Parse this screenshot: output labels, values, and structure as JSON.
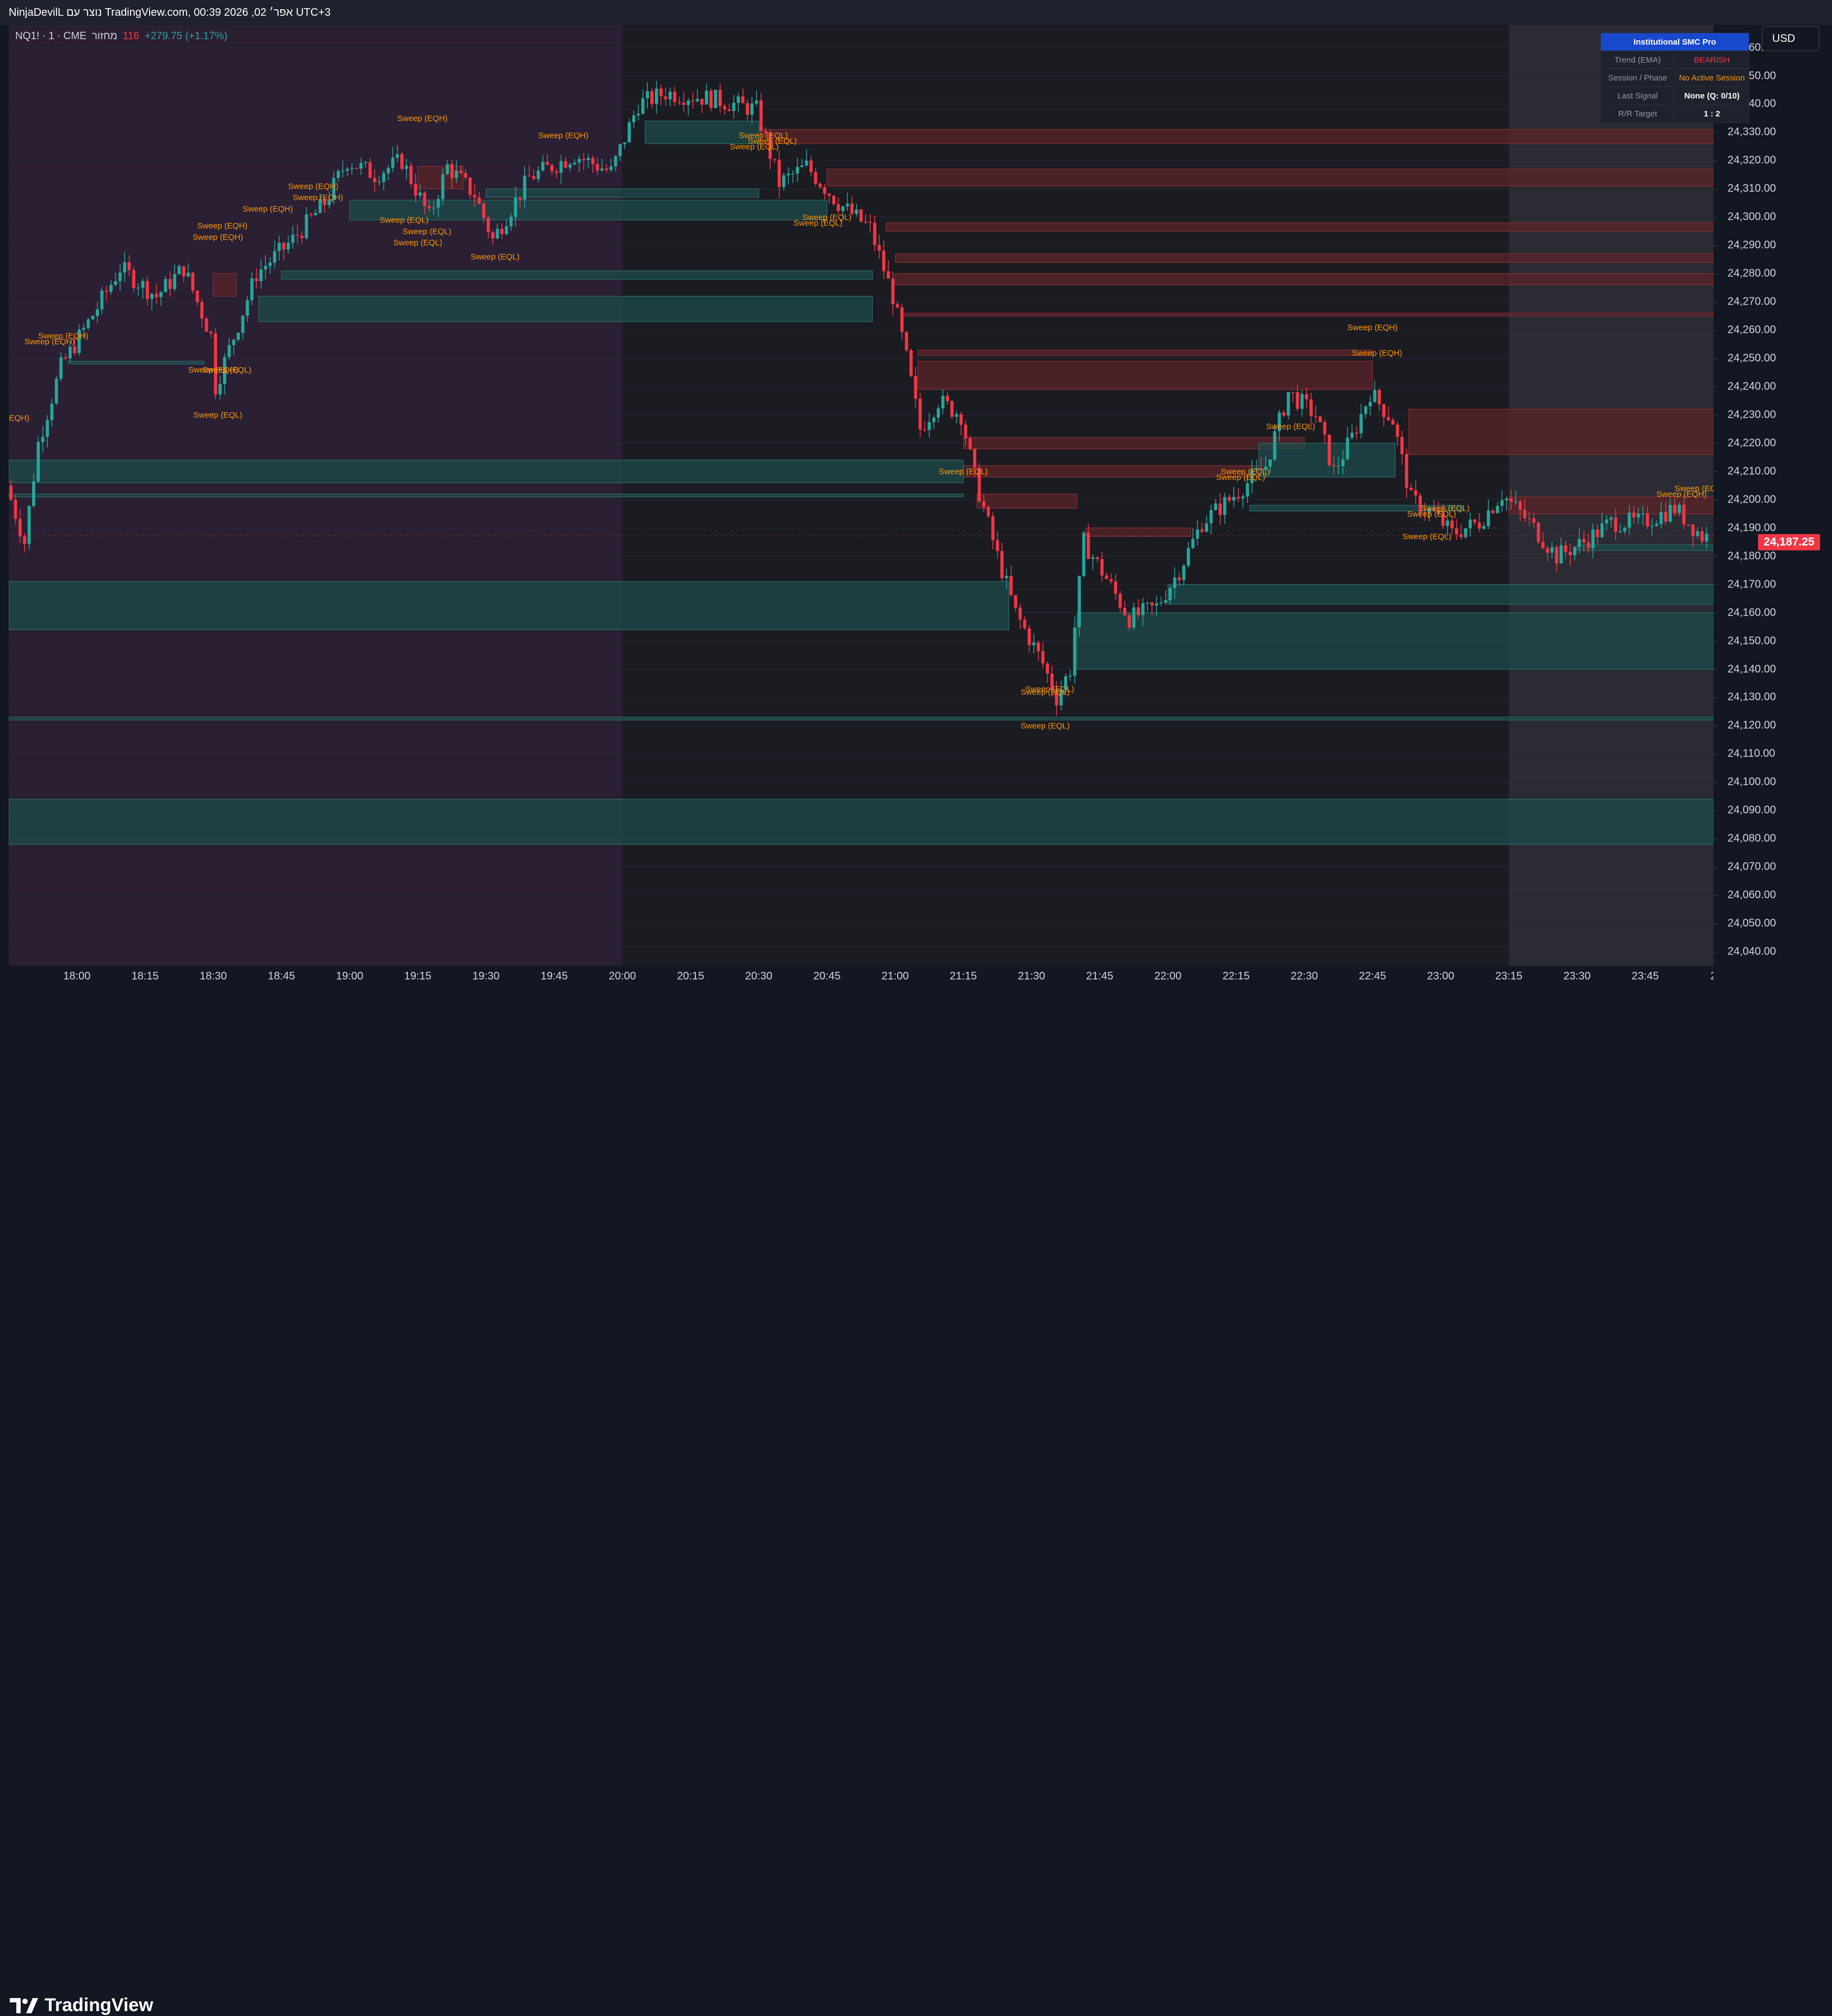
{
  "topbar": {
    "credit_text": "NinjaDevilL נוצר עם TradingView.com, 00:39 2026 ,02 אפר׳ UTC+3"
  },
  "legend": {
    "symbol_text": "NQ1! · 1 · CME",
    "volume_label": "מחזור",
    "volume_value": "116",
    "change_text": "+279.75 (+1.17%)"
  },
  "currency_button": "USD",
  "last_price_label": "24,187.25",
  "smc_table": {
    "title": "Institutional SMC Pro",
    "rows": [
      {
        "key": "Trend (EMA)",
        "value": "BEARISH"
      },
      {
        "key": "Session / Phase",
        "value": "No Active Session"
      },
      {
        "key": "Last Signal",
        "value": "None (Q: 0/10)"
      },
      {
        "key": "R/R Target",
        "value": "1 : 2"
      }
    ]
  },
  "price_axis": {
    "ticks": [
      "24,360.00",
      "24,350.00",
      "24,340.00",
      "24,330.00",
      "24,320.00",
      "24,310.00",
      "24,300.00",
      "24,290.00",
      "24,280.00",
      "24,270.00",
      "24,260.00",
      "24,250.00",
      "24,240.00",
      "24,230.00",
      "24,220.00",
      "24,210.00",
      "24,200.00",
      "24,190.00",
      "24,180.00",
      "24,170.00",
      "24,160.00",
      "24,150.00",
      "24,140.00",
      "24,130.00",
      "24,120.00",
      "24,110.00",
      "24,100.00",
      "24,090.00",
      "24,080.00",
      "24,070.00",
      "24,060.00",
      "24,050.00",
      "24,040.00"
    ]
  },
  "time_axis": {
    "ticks": [
      "7:45",
      "18:00",
      "18:15",
      "18:30",
      "18:45",
      "19:00",
      "19:15",
      "19:30",
      "19:45",
      "20:00",
      "20:15",
      "20:30",
      "20:45",
      "21:00",
      "21:15",
      "21:30",
      "21:45",
      "22:00",
      "22:15",
      "22:30",
      "22:45",
      "23:00",
      "23:15",
      "23:30",
      "23:45",
      "2"
    ]
  },
  "branding": {
    "logo_text": "TradingView",
    "logo_icon": "tradingview-logo-icon"
  },
  "colors": {
    "bull": "#26a69a",
    "bear": "#f23645",
    "sweep_label": "#ff9800",
    "demand_zone": "#1e4b4b",
    "supply_zone": "#5a2428",
    "table_header": "#1848cc"
  },
  "chart_data": {
    "type": "candlestick",
    "y_range": [
      24035,
      24368
    ],
    "x_range": [
      "17:45",
      "00:00"
    ],
    "session_shading": [
      {
        "from": "17:45",
        "to": "20:00",
        "color": "#2a1f33"
      },
      {
        "from": "20:00",
        "to": "23:15",
        "color": "#1b1b22"
      },
      {
        "from": "23:15",
        "to": "00:00",
        "color": "#2a2b33"
      }
    ],
    "price_path": [
      {
        "t": "17:45",
        "p": 24205
      },
      {
        "t": "17:49",
        "p": 24185
      },
      {
        "t": "17:52",
        "p": 24220
      },
      {
        "t": "17:57",
        "p": 24247
      },
      {
        "t": "18:05",
        "p": 24268
      },
      {
        "t": "18:10",
        "p": 24282
      },
      {
        "t": "18:18",
        "p": 24272
      },
      {
        "t": "18:24",
        "p": 24282
      },
      {
        "t": "18:30",
        "p": 24258
      },
      {
        "t": "18:31",
        "p": 24240
      },
      {
        "t": "18:36",
        "p": 24262
      },
      {
        "t": "18:40",
        "p": 24280
      },
      {
        "t": "18:48",
        "p": 24292
      },
      {
        "t": "18:55",
        "p": 24305
      },
      {
        "t": "19:00",
        "p": 24320
      },
      {
        "t": "19:06",
        "p": 24315
      },
      {
        "t": "19:12",
        "p": 24320
      },
      {
        "t": "19:18",
        "p": 24300
      },
      {
        "t": "19:22",
        "p": 24318
      },
      {
        "t": "19:28",
        "p": 24308
      },
      {
        "t": "19:32",
        "p": 24292
      },
      {
        "t": "19:40",
        "p": 24314
      },
      {
        "t": "19:50",
        "p": 24322
      },
      {
        "t": "19:58",
        "p": 24316
      },
      {
        "t": "20:04",
        "p": 24340
      },
      {
        "t": "20:10",
        "p": 24344
      },
      {
        "t": "20:20",
        "p": 24342
      },
      {
        "t": "20:30",
        "p": 24338
      },
      {
        "t": "20:35",
        "p": 24312
      },
      {
        "t": "20:41",
        "p": 24318
      },
      {
        "t": "20:48",
        "p": 24305
      },
      {
        "t": "20:55",
        "p": 24296
      },
      {
        "t": "21:00",
        "p": 24272
      },
      {
        "t": "21:03",
        "p": 24250
      },
      {
        "t": "21:06",
        "p": 24225
      },
      {
        "t": "21:10",
        "p": 24235
      },
      {
        "t": "21:15",
        "p": 24230
      },
      {
        "t": "21:18",
        "p": 24208
      },
      {
        "t": "21:23",
        "p": 24180
      },
      {
        "t": "21:27",
        "p": 24160
      },
      {
        "t": "21:33",
        "p": 24142
      },
      {
        "t": "21:36",
        "p": 24130
      },
      {
        "t": "21:39",
        "p": 24140
      },
      {
        "t": "21:42",
        "p": 24185
      },
      {
        "t": "21:47",
        "p": 24172
      },
      {
        "t": "21:52",
        "p": 24158
      },
      {
        "t": "21:58",
        "p": 24162
      },
      {
        "t": "22:03",
        "p": 24175
      },
      {
        "t": "22:08",
        "p": 24192
      },
      {
        "t": "22:14",
        "p": 24200
      },
      {
        "t": "22:22",
        "p": 24212
      },
      {
        "t": "22:27",
        "p": 24238
      },
      {
        "t": "22:33",
        "p": 24230
      },
      {
        "t": "22:37",
        "p": 24210
      },
      {
        "t": "22:41",
        "p": 24222
      },
      {
        "t": "22:45",
        "p": 24238
      },
      {
        "t": "22:50",
        "p": 24228
      },
      {
        "t": "22:54",
        "p": 24200
      },
      {
        "t": "22:59",
        "p": 24195
      },
      {
        "t": "23:03",
        "p": 24188
      },
      {
        "t": "23:09",
        "p": 24192
      },
      {
        "t": "23:14",
        "p": 24202
      },
      {
        "t": "23:20",
        "p": 24192
      },
      {
        "t": "23:26",
        "p": 24180
      },
      {
        "t": "23:32",
        "p": 24185
      },
      {
        "t": "23:38",
        "p": 24192
      },
      {
        "t": "23:45",
        "p": 24192
      },
      {
        "t": "23:52",
        "p": 24197
      },
      {
        "t": "23:58",
        "p": 24187
      }
    ],
    "zones": [
      {
        "kind": "supply",
        "from": "20:30",
        "to": "00:00",
        "top": 24331,
        "bottom": 24326
      },
      {
        "kind": "supply",
        "from": "20:45",
        "to": "00:00",
        "top": 24317,
        "bottom": 24311
      },
      {
        "kind": "supply",
        "from": "20:58",
        "to": "00:00",
        "top": 24298,
        "bottom": 24295
      },
      {
        "kind": "supply",
        "from": "21:00",
        "to": "00:00",
        "top": 24287,
        "bottom": 24284
      },
      {
        "kind": "supply",
        "from": "21:00",
        "to": "00:00",
        "top": 24280,
        "bottom": 24276
      },
      {
        "kind": "supply",
        "from": "21:02",
        "to": "00:00",
        "top": 24266,
        "bottom": 24265
      },
      {
        "kind": "supply",
        "from": "21:05",
        "to": "22:45",
        "top": 24253,
        "bottom": 24251
      },
      {
        "kind": "supply",
        "from": "21:05",
        "to": "22:45",
        "top": 24249,
        "bottom": 24239
      },
      {
        "kind": "supply",
        "from": "22:53",
        "to": "00:00",
        "top": 24232,
        "bottom": 24216
      },
      {
        "kind": "supply",
        "from": "21:15",
        "to": "22:30",
        "top": 24222,
        "bottom": 24218
      },
      {
        "kind": "supply",
        "from": "21:15",
        "to": "22:20",
        "top": 24212,
        "bottom": 24208
      },
      {
        "kind": "supply",
        "from": "21:18",
        "to": "21:40",
        "top": 24202,
        "bottom": 24197
      },
      {
        "kind": "supply",
        "from": "23:15",
        "to": "00:00",
        "top": 24201,
        "bottom": 24195
      },
      {
        "kind": "supply",
        "from": "21:42",
        "to": "22:05",
        "top": 24190,
        "bottom": 24187
      },
      {
        "kind": "supply",
        "from": "18:30",
        "to": "18:35",
        "top": 24280,
        "bottom": 24272
      },
      {
        "kind": "supply",
        "from": "19:15",
        "to": "19:25",
        "top": 24318,
        "bottom": 24310
      },
      {
        "kind": "demand",
        "from": "20:05",
        "to": "20:30",
        "top": 24334,
        "bottom": 24326
      },
      {
        "kind": "demand",
        "from": "19:30",
        "to": "20:30",
        "top": 24310,
        "bottom": 24307
      },
      {
        "kind": "demand",
        "from": "19:00",
        "to": "20:45",
        "top": 24306,
        "bottom": 24299
      },
      {
        "kind": "demand",
        "from": "18:45",
        "to": "20:55",
        "top": 24281,
        "bottom": 24278
      },
      {
        "kind": "demand",
        "from": "18:40",
        "to": "20:55",
        "top": 24272,
        "bottom": 24263
      },
      {
        "kind": "demand",
        "from": "17:58",
        "to": "18:28",
        "top": 24249,
        "bottom": 24248
      },
      {
        "kind": "demand",
        "from": "17:45",
        "to": "21:15",
        "top": 24214,
        "bottom": 24206
      },
      {
        "kind": "demand",
        "from": "17:45",
        "to": "21:15",
        "top": 24202,
        "bottom": 24201
      },
      {
        "kind": "demand",
        "from": "22:20",
        "to": "22:50",
        "top": 24220,
        "bottom": 24208
      },
      {
        "kind": "demand",
        "from": "22:18",
        "to": "23:05",
        "top": 24198,
        "bottom": 24196
      },
      {
        "kind": "demand",
        "from": "17:45",
        "to": "21:25",
        "top": 24171,
        "bottom": 24154
      },
      {
        "kind": "demand",
        "from": "22:00",
        "to": "00:00",
        "top": 24170,
        "bottom": 24163
      },
      {
        "kind": "demand",
        "from": "21:40",
        "to": "00:00",
        "top": 24160,
        "bottom": 24140
      },
      {
        "kind": "demand",
        "from": "23:30",
        "to": "00:00",
        "top": 24184,
        "bottom": 24182
      },
      {
        "kind": "demand",
        "from": "17:45",
        "to": "00:00",
        "top": 24123,
        "bottom": 24122
      },
      {
        "kind": "demand",
        "from": "17:45",
        "to": "00:00",
        "top": 24094,
        "bottom": 24078
      }
    ],
    "labels": [
      {
        "text": "Sweep (EQH)",
        "t": "19:16",
        "p": 24334
      },
      {
        "text": "Sweep (EQH)",
        "t": "19:47",
        "p": 24328
      },
      {
        "text": "Sweep (EQH)",
        "t": "18:42",
        "p": 24302
      },
      {
        "text": "Sweep (EQH)",
        "t": "18:52",
        "p": 24310
      },
      {
        "text": "Sweep (EQH)",
        "t": "18:53",
        "p": 24306
      },
      {
        "text": "Sweep (EQH)",
        "t": "18:32",
        "p": 24296
      },
      {
        "text": "Sweep (EQH)",
        "t": "18:31",
        "p": 24292
      },
      {
        "text": "Sweep (EQL)",
        "t": "19:12",
        "p": 24298
      },
      {
        "text": "Sweep (EQL)",
        "t": "19:17",
        "p": 24294
      },
      {
        "text": "Sweep (EQL)",
        "t": "19:15",
        "p": 24290
      },
      {
        "text": "Sweep (EQL)",
        "t": "19:32",
        "p": 24285
      },
      {
        "text": "Sweep (EQH)",
        "t": "17:57",
        "p": 24257
      },
      {
        "text": "Sweep (EQH)",
        "t": "17:54",
        "p": 24255
      },
      {
        "text": "Sweep (EQH)",
        "t": "18:30",
        "p": 24245
      },
      {
        "text": "Sweep (EQL)",
        "t": "18:33",
        "p": 24245
      },
      {
        "text": "Sweep (EQL)",
        "t": "18:31",
        "p": 24229
      },
      {
        "text": "(EQH)",
        "t": "17:47",
        "p": 24228
      },
      {
        "text": "Sweep (EQL)",
        "t": "20:31",
        "p": 24328
      },
      {
        "text": "Sweep (EQL)",
        "t": "20:33",
        "p": 24326
      },
      {
        "text": "Sweep (EQL)",
        "t": "20:29",
        "p": 24324
      },
      {
        "text": "Sweep (EQL)",
        "t": "20:45",
        "p": 24299
      },
      {
        "text": "Sweep (EQL)",
        "t": "20:43",
        "p": 24297
      },
      {
        "text": "Sweep (EQL)",
        "t": "21:15",
        "p": 24209
      },
      {
        "text": "Sweep (EQH)",
        "t": "22:45",
        "p": 24260
      },
      {
        "text": "Sweep (EQH)",
        "t": "22:46",
        "p": 24251
      },
      {
        "text": "Sweep (EQL)",
        "t": "22:27",
        "p": 24225
      },
      {
        "text": "Sweep (EQL)",
        "t": "22:17",
        "p": 24209
      },
      {
        "text": "Sweep (EQL)",
        "t": "22:16",
        "p": 24207
      },
      {
        "text": "Sweep (EQL)",
        "t": "23:01",
        "p": 24196
      },
      {
        "text": "Sweep (EQL)",
        "t": "22:58",
        "p": 24194
      },
      {
        "text": "Sweep (EQL)",
        "t": "22:57",
        "p": 24186
      },
      {
        "text": "Sweep (EQH)",
        "t": "23:57",
        "p": 24203
      },
      {
        "text": "Sweep (EQH)",
        "t": "23:53",
        "p": 24201
      },
      {
        "text": "Sweep (EQL)",
        "t": "21:34",
        "p": 24132
      },
      {
        "text": "Sweep (EQL)",
        "t": "21:33",
        "p": 24131
      },
      {
        "text": "Sweep (EQL)",
        "t": "21:33",
        "p": 24119
      }
    ]
  }
}
